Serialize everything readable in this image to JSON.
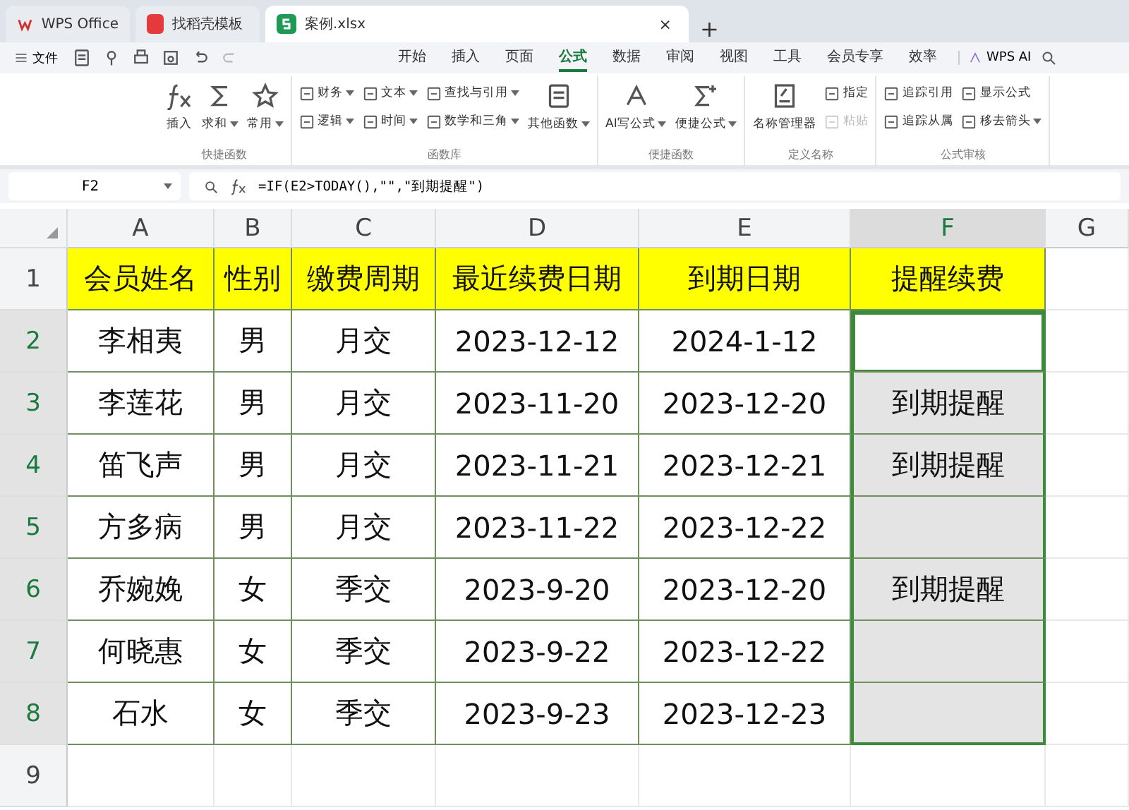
{
  "title_tabs": [
    {
      "label": "WPS Office",
      "kind": "home",
      "selected": false
    },
    {
      "label": "找稻壳模板",
      "kind": "template",
      "selected": false
    },
    {
      "label": "案例.xlsx",
      "kind": "sheet",
      "selected": true,
      "close": "×"
    }
  ],
  "new_tab": "+",
  "file_menu": "文件",
  "menu_tabs": [
    {
      "label": "开始",
      "selected": false
    },
    {
      "label": "插入",
      "selected": false
    },
    {
      "label": "页面",
      "selected": false
    },
    {
      "label": "公式",
      "selected": true
    },
    {
      "label": "数据",
      "selected": false
    },
    {
      "label": "审阅",
      "selected": false
    },
    {
      "label": "视图",
      "selected": false
    },
    {
      "label": "工具",
      "selected": false
    },
    {
      "label": "会员专享",
      "selected": false
    },
    {
      "label": "效率",
      "selected": false
    }
  ],
  "ai_button": "WPS AI",
  "ribbon_groups": [
    {
      "title": "快捷函数",
      "columns": [
        [
          {
            "label": "插入",
            "kind": "large",
            "disabled": false,
            "dropdown": false
          }
        ],
        [
          {
            "label": "求和",
            "kind": "large",
            "disabled": false,
            "dropdown": true
          }
        ],
        [
          {
            "label": "常用",
            "kind": "large",
            "disabled": false,
            "dropdown": true
          }
        ]
      ]
    },
    {
      "title": "函数库",
      "columns": [
        [
          {
            "label": "财务",
            "kind": "small",
            "disabled": false,
            "dropdown": true
          },
          {
            "label": "逻辑",
            "kind": "small",
            "disabled": false,
            "dropdown": true
          }
        ],
        [
          {
            "label": "文本",
            "kind": "small",
            "disabled": false,
            "dropdown": true
          },
          {
            "label": "时间",
            "kind": "small",
            "disabled": false,
            "dropdown": true
          }
        ],
        [
          {
            "label": "查找与引用",
            "kind": "small",
            "disabled": false,
            "dropdown": true
          },
          {
            "label": "数学和三角",
            "kind": "small",
            "disabled": false,
            "dropdown": true
          }
        ],
        [
          {
            "label": "其他函数",
            "kind": "large",
            "disabled": false,
            "dropdown": true
          }
        ]
      ]
    },
    {
      "title": "便捷函数",
      "columns": [
        [
          {
            "label": "AI写公式",
            "kind": "large",
            "disabled": false,
            "dropdown": true
          }
        ],
        [
          {
            "label": "便捷公式",
            "kind": "large",
            "disabled": false,
            "dropdown": true
          }
        ]
      ]
    },
    {
      "title": "定义名称",
      "columns": [
        [
          {
            "label": "名称管理器",
            "kind": "large",
            "disabled": false,
            "dropdown": false
          }
        ],
        [
          {
            "label": "指定",
            "kind": "small",
            "disabled": false,
            "dropdown": false
          },
          {
            "label": "粘贴",
            "kind": "small",
            "disabled": true,
            "dropdown": false
          }
        ]
      ]
    },
    {
      "title": "公式审核",
      "columns": [
        [
          {
            "label": "追踪引用",
            "kind": "small",
            "disabled": false,
            "dropdown": false
          },
          {
            "label": "追踪从属",
            "kind": "small",
            "disabled": false,
            "dropdown": false
          }
        ],
        [
          {
            "label": "显示公式",
            "kind": "small",
            "disabled": false,
            "dropdown": false
          },
          {
            "label": "移去箭头",
            "kind": "small",
            "disabled": false,
            "dropdown": true
          }
        ]
      ]
    }
  ],
  "name_box": "F2",
  "formula": "=IF(E2>TODAY(),\"\",\"到期提醒\")",
  "columns": [
    {
      "label": "A",
      "selected": false
    },
    {
      "label": "B",
      "selected": false
    },
    {
      "label": "C",
      "selected": false
    },
    {
      "label": "D",
      "selected": false
    },
    {
      "label": "E",
      "selected": false
    },
    {
      "label": "F",
      "selected": true
    },
    {
      "label": "G",
      "selected": false
    }
  ],
  "rows": [
    {
      "number": "1",
      "kind": "header",
      "selected": false,
      "active": false,
      "cells": [
        "会员姓名",
        "性别",
        "缴费周期",
        "最近续费日期",
        "到期日期",
        "提醒续费"
      ]
    },
    {
      "number": "2",
      "kind": "data",
      "selected": true,
      "active": true,
      "cells": [
        "李相夷",
        "男",
        "月交",
        "2023-12-12",
        "2024-1-12",
        ""
      ]
    },
    {
      "number": "3",
      "kind": "data",
      "selected": true,
      "active": false,
      "cells": [
        "李莲花",
        "男",
        "月交",
        "2023-11-20",
        "2023-12-20",
        "到期提醒"
      ]
    },
    {
      "number": "4",
      "kind": "data",
      "selected": true,
      "active": false,
      "cells": [
        "笛飞声",
        "男",
        "月交",
        "2023-11-21",
        "2023-12-21",
        "到期提醒"
      ]
    },
    {
      "number": "5",
      "kind": "data",
      "selected": true,
      "active": false,
      "cells": [
        "方多病",
        "男",
        "月交",
        "2023-11-22",
        "2023-12-22",
        ""
      ]
    },
    {
      "number": "6",
      "kind": "data",
      "selected": true,
      "active": false,
      "cells": [
        "乔婉娩",
        "女",
        "季交",
        "2023-9-20",
        "2023-12-20",
        "到期提醒"
      ]
    },
    {
      "number": "7",
      "kind": "data",
      "selected": true,
      "active": false,
      "cells": [
        "何晓惠",
        "女",
        "季交",
        "2023-9-22",
        "2023-12-22",
        ""
      ]
    },
    {
      "number": "8",
      "kind": "data",
      "selected": true,
      "active": false,
      "cells": [
        "石水",
        "女",
        "季交",
        "2023-9-23",
        "2023-12-23",
        ""
      ]
    },
    {
      "number": "9",
      "kind": "empty",
      "selected": false,
      "active": false,
      "cells": []
    }
  ]
}
